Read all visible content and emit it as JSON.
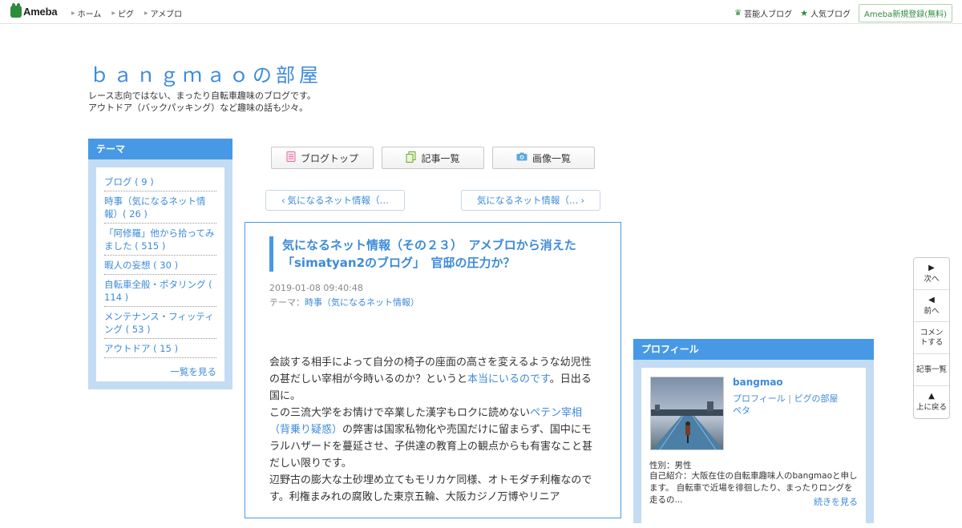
{
  "topbar": {
    "logo_text": "Ameba",
    "nav": [
      "ホーム",
      "ピグ",
      "アメブロ"
    ],
    "links": [
      "芸能人ブログ",
      "人気ブログ"
    ],
    "signup_label": "Ameba新規登録(無料)"
  },
  "blog": {
    "title": "ｂａｎｇｍａｏの部屋",
    "desc_line1": "レース志向ではない、まったり自転車趣味のブログです。",
    "desc_line2": "アウトドア（バックパッキング）など趣味の話も少々。"
  },
  "theme": {
    "heading": "テーマ",
    "items": [
      "ブログ ( 9 )",
      "時事（気になるネット情報）( 26 )",
      "「阿修羅」他から拾ってみました ( 515 )",
      "暇人の妄想 ( 30 )",
      "自転車全般・ポタリング ( 114 )",
      "メンテナンス・フィッティング ( 53 )",
      "アウトドア ( 15 )"
    ],
    "more_label": "一覧を見る"
  },
  "buttons": {
    "blog_top": "ブログトップ",
    "entry_list": "記事一覧",
    "image_list": "画像一覧"
  },
  "pager": {
    "prev": "気になるネット情報（…",
    "next": "気になるネット情報（…"
  },
  "article": {
    "title": "気になるネット情報（その２３）　アメブロから消えた「simatyan2のブログ」　官邸の圧力か？",
    "date": "2019-01-08 09:40:48",
    "theme_label": "テーマ：",
    "theme_link": "時事（気になるネット情報）",
    "p1_a": "会談する相手によって自分の椅子の座面の高さを変えるような幼児性の甚だしい宰相が今時いるのか？というと",
    "p1_link": "本当にいるのです",
    "p1_b": "。日出る国に。",
    "p2_a": "この三流大学をお情けで卒業した漢字もロクに読めない",
    "p2_link": "ペテン宰相（背乗り疑惑）",
    "p2_b": "の弊害は国家私物化や売国だけに留まらず、国中にモラルハザードを蔓延させ、子供達の教育上の観点からも有害なこと甚だしい限りです。",
    "p3": "辺野古の膨大な土砂埋め立てもモリカケ同様、オトモダチ利権なのです。利権まみれの腐敗した東京五輪、大阪カジノ万博やリニア"
  },
  "profile": {
    "heading": "プロフィール",
    "name": "bangmao",
    "link_profile": "プロフィール",
    "link_pigg": "ピグの部屋",
    "link_peta": "ペタ",
    "gender": "性別：男性",
    "intro": "自己紹介：大阪在住の自転車趣味人のbangmaoと申します。 自転車で近場を徘徊したり、まったりロングを走るの...",
    "more_label": "続きを見る"
  },
  "sidenav": {
    "next": "次へ",
    "prev": "前へ",
    "comment": "コメントする",
    "entries": "記事一覧",
    "top": "上に戻る"
  },
  "colors": {
    "accent": "#4799e6",
    "link": "#3d8bd9",
    "brand_green": "#2d8c3c",
    "panel": "#c3dcf3"
  }
}
